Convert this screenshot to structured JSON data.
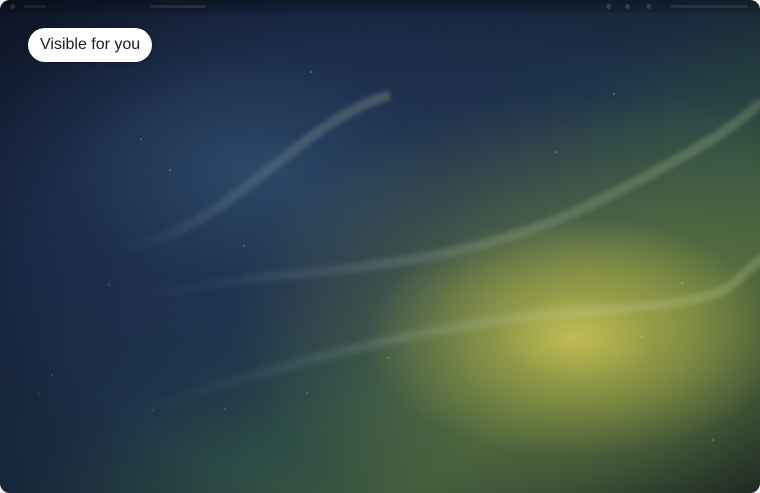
{
  "badge": {
    "label": "Visible for you"
  },
  "wallpaper": {
    "colors": {
      "deep_navy": "#0d1426",
      "blue": "#1d3148",
      "teal_green": "#2c4b46",
      "glow_yellow": "#c6c054"
    }
  },
  "icons": {
    "status_indicators": [
      "status-dot-icon",
      "status-dot-icon",
      "status-dot-icon"
    ]
  }
}
